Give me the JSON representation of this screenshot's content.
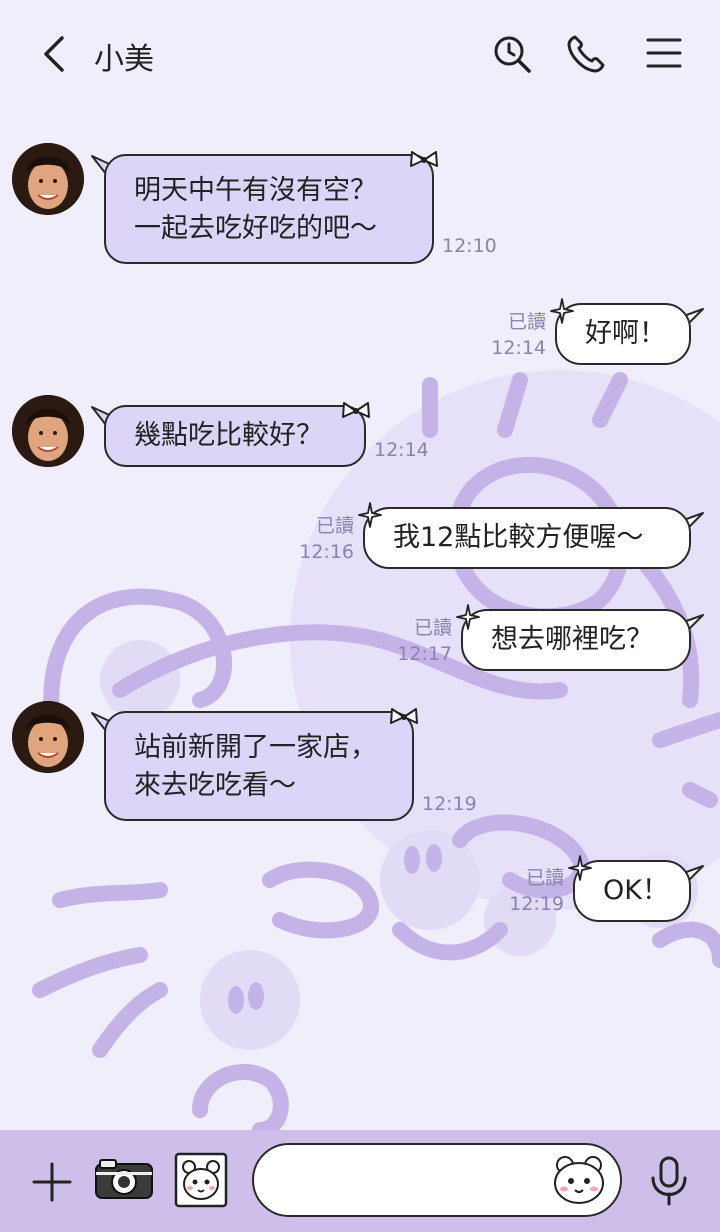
{
  "header": {
    "title": "小美",
    "back_icon": "chevron-left-icon",
    "search_icon": "search-icon",
    "call_icon": "phone-icon",
    "menu_icon": "menu-icon"
  },
  "messages": [
    {
      "side": "in",
      "lines": [
        "明天中午有沒有空？",
        "一起去吃好吃的吧～"
      ],
      "time": "12:10"
    },
    {
      "side": "out",
      "text": "好啊！",
      "status": "已讀",
      "time": "12:14"
    },
    {
      "side": "in",
      "text": "幾點吃比較好？",
      "time": "12:14"
    },
    {
      "side": "out",
      "text": "我12點比較方便喔～",
      "status": "已讀",
      "time": "12:16"
    },
    {
      "side": "out",
      "text": "想去哪裡吃？",
      "status": "已讀",
      "time": "12:17"
    },
    {
      "side": "in",
      "lines": [
        "站前新開了一家店，",
        "來去吃吃看～"
      ],
      "time": "12:19"
    },
    {
      "side": "out",
      "text": "OK！",
      "status": "已讀",
      "time": "12:19"
    }
  ],
  "input": {
    "placeholder": "",
    "value": ""
  },
  "footer": {
    "add_icon": "plus-icon",
    "camera_icon": "camera-icon",
    "sticker_icon": "sticker-icon",
    "emoji_icon": "emoji-icon",
    "mic_icon": "microphone-icon"
  },
  "colors": {
    "background": "#f1eefb",
    "incoming_bubble": "#dcd5f7",
    "outgoing_bubble": "#ffffff",
    "footer": "#cdbfe9",
    "timestamp": "#8b82ad",
    "decoration": "#c4b3e6"
  }
}
